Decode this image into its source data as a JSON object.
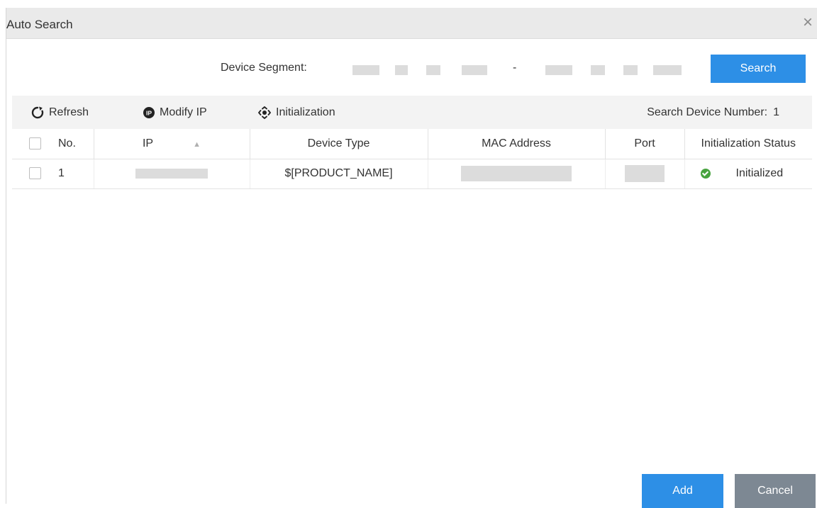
{
  "dialog": {
    "title": "Auto Search",
    "close_glyph": "×"
  },
  "segment": {
    "label": "Device Segment:",
    "separator": "-",
    "start_value": "",
    "end_value": "",
    "search_label": "Search"
  },
  "toolbar": {
    "refresh_label": "Refresh",
    "modify_ip_label": "Modify IP",
    "initialization_label": "Initialization",
    "device_number_label": "Search Device Number:",
    "device_number_value": "1"
  },
  "table": {
    "columns": [
      "No.",
      "IP",
      "Device Type",
      "MAC Address",
      "Port",
      "Initialization Status"
    ],
    "rows": [
      {
        "no": "1",
        "ip": "",
        "device_type": "$[PRODUCT_NAME]",
        "mac": "",
        "port": "",
        "status": "Initialized"
      }
    ]
  },
  "footer": {
    "add_label": "Add",
    "cancel_label": "Cancel"
  },
  "colors": {
    "primary": "#2d8fe6",
    "secondary": "#7d8893",
    "status_ok": "#48a33f"
  },
  "icons": {
    "close": "close-icon",
    "refresh": "refresh-icon",
    "modify_ip": "ip-icon",
    "initialization": "initialization-icon",
    "sort": "sort-up-icon",
    "status": "check-circle-icon"
  }
}
